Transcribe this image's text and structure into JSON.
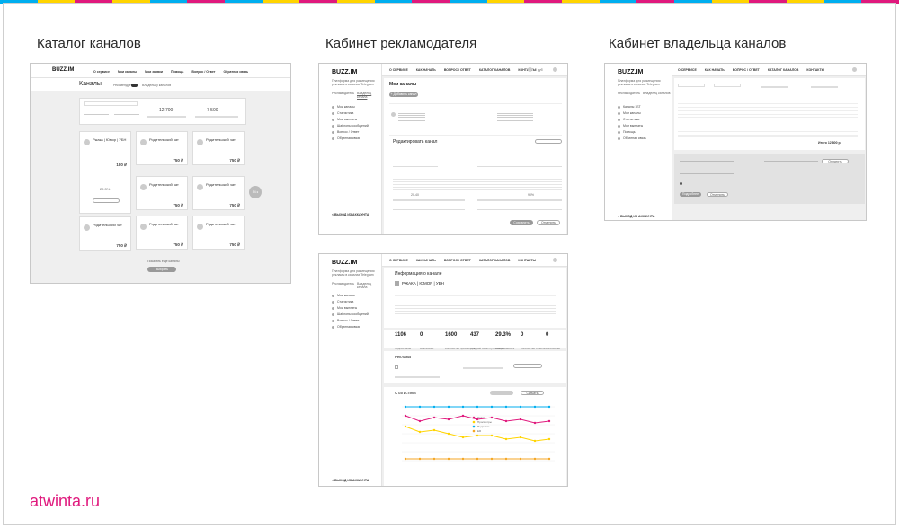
{
  "headings": {
    "catalog": "Каталог каналов",
    "advertiser": "Кабинет рекламодателя",
    "owner": "Кабинет владельца каналов"
  },
  "footer": {
    "site": "atwinta.ru"
  },
  "stripe_colors": [
    "#00aeef",
    "#ffd400",
    "#e0197d",
    "#ffd400",
    "#00aeef",
    "#e0197d"
  ],
  "brand": {
    "logo": "BUZZ.IM"
  },
  "catalog": {
    "nav": [
      "О сервисе",
      "Мои каналы",
      "Мои заявки",
      "Помощь",
      "Вопрос / Ответ",
      "Обратная связь"
    ],
    "title": "Каналы",
    "tab_recommend": "Рекомендуется",
    "tab_other": "Владельцу каналов",
    "price_value": "12 700",
    "reach_value": "7 500",
    "card_title": "Родительский чат",
    "card_title_2": "Ржака | Юмор | УБН",
    "card_price": "750 ₽",
    "card_price_2": "180 ₽",
    "card_percent": "29.3%",
    "side_count": "54 к",
    "more": "Показать еще каналы",
    "cta": "Выбрать"
  },
  "advertiser": {
    "tagline": "Платформа для размещения рекламы в каналах Telegram",
    "tabs": [
      "Рекламодатель",
      "Владелец канала"
    ],
    "nav": [
      "О СЕРВИСЕ",
      "КАК НАЧАТЬ",
      "ВОПРОС / ОТВЕТ",
      "КАТАЛОГ КАНАЛОВ",
      "КОНТАКТЫ"
    ],
    "balance": "0 руб",
    "title": "Мои каналы",
    "add_btn": "+ Добавить канал",
    "sidebar": [
      "Мои каналы",
      "Статистика",
      "Мои выплаты",
      "Шаблоны сообщений",
      "Вопрос / Ответ",
      "Обратная связь"
    ],
    "edit_title": "Редактировать канал",
    "range_a": "20-40",
    "range_b": "90%",
    "save": "Сохранить",
    "cancel": "Отменить",
    "logout": "< ВЫХОД ИЗ АККАУНТА"
  },
  "stats": {
    "title": "Информация о канале",
    "channel": "РЖАКА | ЮМОР | УБН",
    "numbers": [
      {
        "v": "1106",
        "l": "Подписчиков"
      },
      {
        "v": "0",
        "l": "Вовлеченн."
      },
      {
        "v": "1600",
        "l": "Количество просмотров"
      },
      {
        "v": "437",
        "l": "Средний охват публикации"
      },
      {
        "v": "29.3%",
        "l": "Вовлеченность"
      },
      {
        "v": "0",
        "l": "Количество отписок"
      },
      {
        "v": "0",
        "l": "Количество подписок"
      }
    ],
    "ads_title": "Реклама",
    "chart_title": "Статистика",
    "chart_btn": "Скачать",
    "legend": [
      "Охват",
      "Просмотры",
      "Подписки",
      "ER"
    ],
    "series_colors": [
      "#e0197d",
      "#ffd400",
      "#00aeef",
      "#f5a623"
    ]
  },
  "owner": {
    "tagline": "Платформа для размещения рекламы в каналах Telegram",
    "tabs": [
      "Рекламодатель",
      "Владелец каналов"
    ],
    "nav": [
      "О СЕРВИСЕ",
      "КАК НАЧАТЬ",
      "ВОПРОС / ОТВЕТ",
      "КАТАЛОГ КАНАЛОВ",
      "КОНТАКТЫ"
    ],
    "sidebar": [
      "Каналы 1БТ",
      "Мои каналы",
      "Статистика",
      "Мои выплаты",
      "Помощь",
      "Обратная связь"
    ],
    "total": "Итого 12 800 р.",
    "btn_pay": "Оплатить",
    "btn_more": "Подробнее",
    "logout": "< ВЫХОД ИЗ АККАУНТА"
  }
}
